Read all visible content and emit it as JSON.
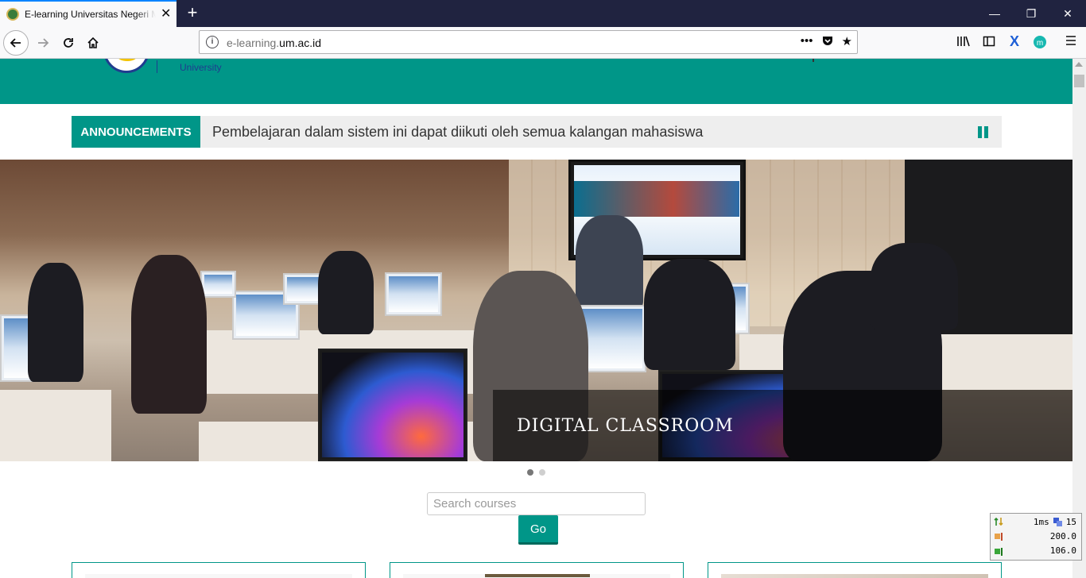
{
  "browser": {
    "tab_title": "E-learning Universitas Negeri Malang",
    "tab_close": "✕",
    "new_tab": "+",
    "window_controls": [
      "—",
      "❐",
      "✕"
    ],
    "url_prefix": "e-learning.",
    "url_domain": "um.ac.id",
    "url_actions": [
      "•••",
      "pocket-icon",
      "★"
    ],
    "toolbar_icons": [
      "library-icon",
      "sidebar-icon",
      "x-extension-icon",
      "m-extension-icon",
      "menu-icon"
    ]
  },
  "site": {
    "logo_text": "University",
    "announcement": {
      "label": "ANNOUNCEMENTS",
      "text": "Pembelajaran dalam sistem ini dapat diikuti oleh semua kalangan mahasiswa"
    },
    "slider": {
      "caption": "DIGITAL CLASSROOM",
      "slide_count": 2,
      "active_slide": 1
    },
    "search": {
      "placeholder": "Search courses",
      "value": "",
      "button_label": "Go"
    }
  },
  "perf_widget": {
    "row1": [
      "1ms",
      "15"
    ],
    "row2": "200.0",
    "row3": "106.0"
  },
  "colors": {
    "primary": "#009688",
    "chrome_dark": "#202340",
    "logo_blue": "#1f3c8f"
  }
}
